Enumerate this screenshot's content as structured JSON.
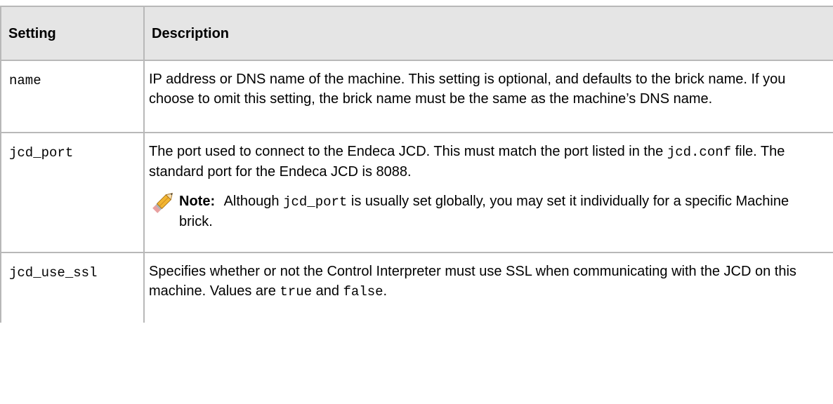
{
  "table": {
    "headers": {
      "setting": "Setting",
      "description": "Description"
    },
    "rows": [
      {
        "setting": "name",
        "description": "IP address or DNS name of the machine. This setting is optional, and defaults to the brick name. If you choose to omit this setting, the brick name must be the same as the machine’s DNS name."
      },
      {
        "setting": "jcd_port",
        "description_part1": "The port used to connect to the Endeca JCD. This must match the port listed in the",
        "description_code": "jcd.conf",
        "description_part2": "file. The standard port for the Endeca JCD is 8088.",
        "note": {
          "icon": "pencil-icon",
          "label": "Note:",
          "text_part1": "Although",
          "code": "jcd_port",
          "text_part2": "is usually set globally, you may set it individually for a specific Machine brick."
        }
      },
      {
        "setting": "jcd_use_ssl",
        "description_part1": "Specifies whether or not the Control Interpreter must use SSL when communicating with the JCD on this machine. Values are",
        "code_true": "true",
        "and_text": "and",
        "code_false": "false",
        "period": "."
      }
    ]
  }
}
